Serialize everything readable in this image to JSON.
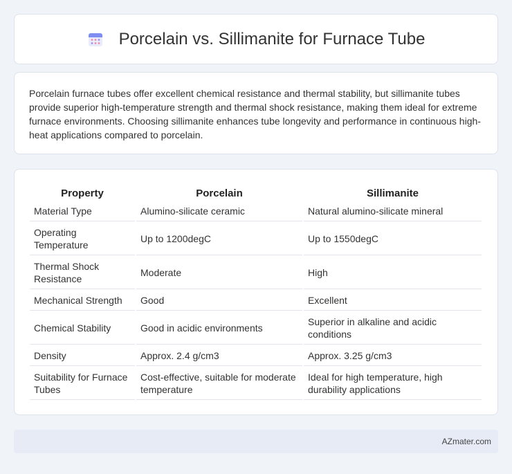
{
  "header": {
    "title": "Porcelain vs. Sillimanite for Furnace Tube",
    "icon": "calendar-icon"
  },
  "intro": {
    "text": "Porcelain furnace tubes offer excellent chemical resistance and thermal stability, but sillimanite tubes provide superior high-temperature strength and thermal shock resistance, making them ideal for extreme furnace environments. Choosing sillimanite enhances tube longevity and performance in continuous high-heat applications compared to porcelain."
  },
  "table": {
    "headers": [
      "Property",
      "Porcelain",
      "Sillimanite"
    ],
    "rows": [
      [
        "Material Type",
        "Alumino-silicate ceramic",
        "Natural alumino-silicate mineral"
      ],
      [
        "Operating Temperature",
        "Up to 1200degC",
        "Up to 1550degC"
      ],
      [
        "Thermal Shock Resistance",
        "Moderate",
        "High"
      ],
      [
        "Mechanical Strength",
        "Good",
        "Excellent"
      ],
      [
        "Chemical Stability",
        "Good in acidic environments",
        "Superior in alkaline and acidic conditions"
      ],
      [
        "Density",
        "Approx. 2.4 g/cm3",
        "Approx. 3.25 g/cm3"
      ],
      [
        "Suitability for Furnace Tubes",
        "Cost-effective, suitable for moderate temperature",
        "Ideal for high temperature, high durability applications"
      ]
    ]
  },
  "footer": {
    "text": "AZmater.com"
  },
  "colors": {
    "background": "#f0f3f8",
    "card": "#ffffff",
    "footer": "#e6ebf5"
  }
}
